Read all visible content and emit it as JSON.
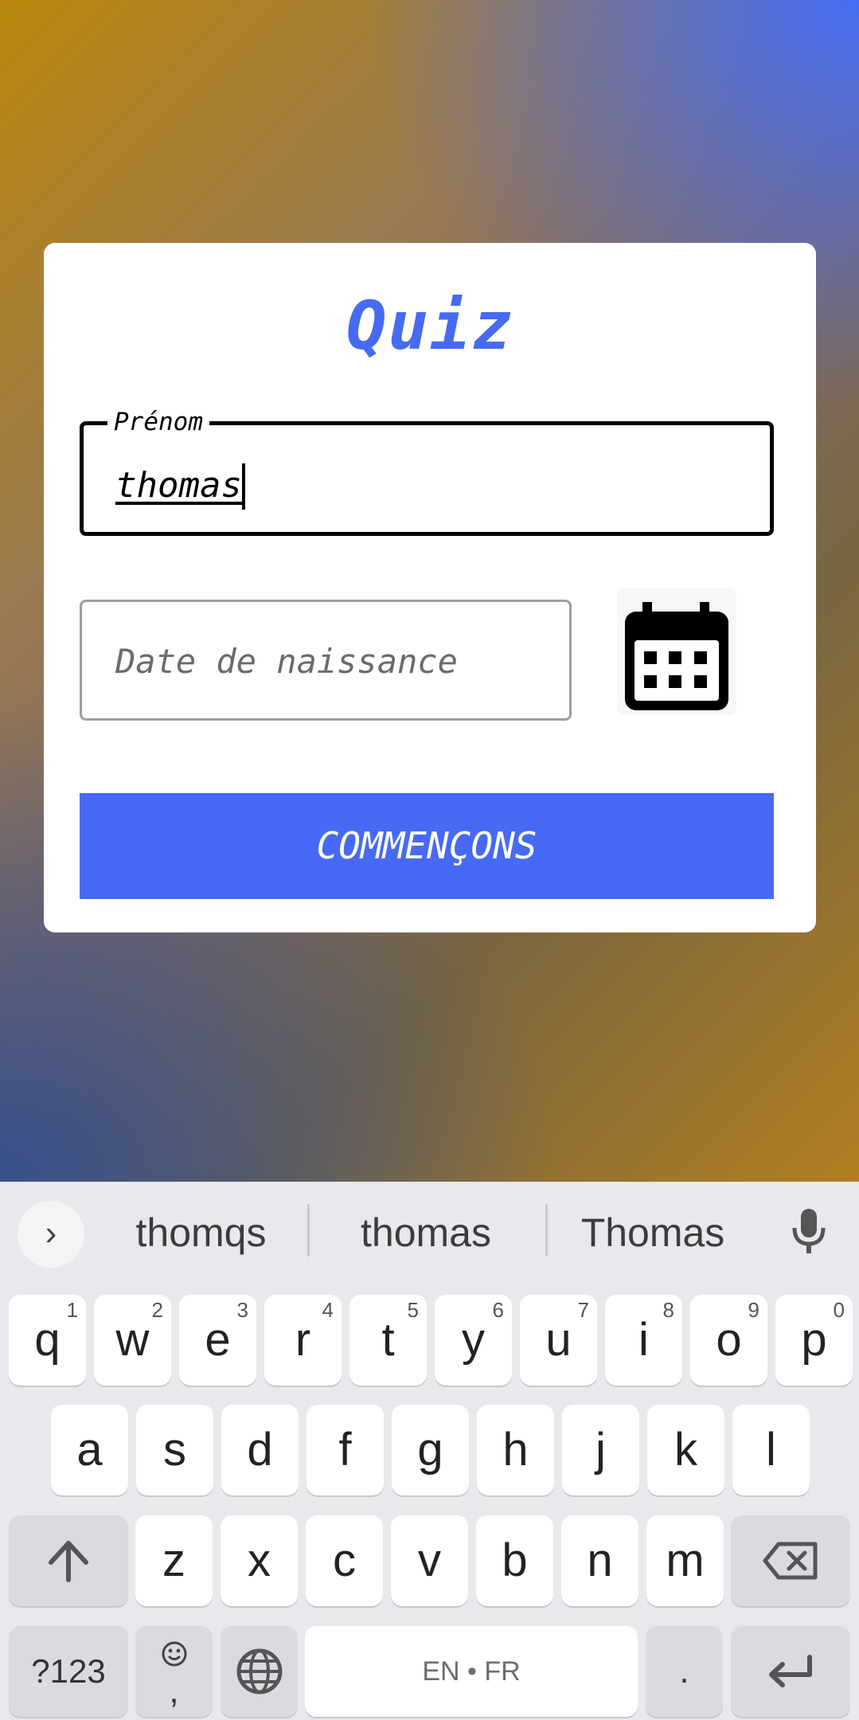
{
  "quiz": {
    "title": "Quiz",
    "name_label": "Prénom",
    "name_value": "thomas",
    "date_placeholder": "Date de naissance",
    "start_label": "COMMENÇONS",
    "accent_color": "#466af5"
  },
  "keyboard": {
    "suggestions": [
      "thomqs",
      "thomas",
      "Thomas"
    ],
    "row1": [
      {
        "k": "q",
        "h": "1"
      },
      {
        "k": "w",
        "h": "2"
      },
      {
        "k": "e",
        "h": "3"
      },
      {
        "k": "r",
        "h": "4"
      },
      {
        "k": "t",
        "h": "5"
      },
      {
        "k": "y",
        "h": "6"
      },
      {
        "k": "u",
        "h": "7"
      },
      {
        "k": "i",
        "h": "8"
      },
      {
        "k": "o",
        "h": "9"
      },
      {
        "k": "p",
        "h": "0"
      }
    ],
    "row2": [
      "a",
      "s",
      "d",
      "f",
      "g",
      "h",
      "j",
      "k",
      "l"
    ],
    "row3": [
      "z",
      "x",
      "c",
      "v",
      "b",
      "n",
      "m"
    ],
    "sym_label": "?123",
    "comma_label": ",",
    "space_label": "EN • FR",
    "period_label": "."
  }
}
